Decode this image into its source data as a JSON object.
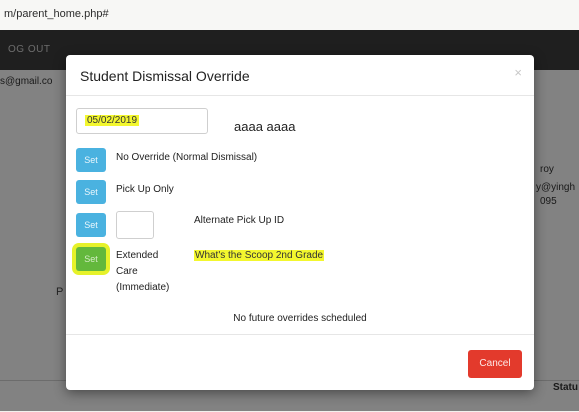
{
  "browser": {
    "url": "m/parent_home.php#"
  },
  "background": {
    "logout_label": "OG OUT",
    "email_fragment": "s@gmail.co",
    "right_fragment_1": "roy",
    "right_fragment_2": "y@yingh",
    "right_fragment_3": "095",
    "p_fragment": "P",
    "status_header": "Statu"
  },
  "modal": {
    "title": "Student Dismissal Override",
    "close_glyph": "×",
    "date_value": "05/02/2019",
    "student_name": "aaaa aaaa",
    "options": [
      {
        "button_label": "Set",
        "label": "No Override (Normal Dismissal)"
      },
      {
        "button_label": "Set",
        "label": "Pick Up Only"
      },
      {
        "button_label": "Set",
        "label": "Alternate Pick Up ID"
      },
      {
        "button_label": "Set",
        "label_line1": "Extended",
        "label_line2": "Care",
        "label_line3": "(Immediate)"
      }
    ],
    "activity": "What's the Scoop 2nd Grade",
    "no_future_text": "No future overrides scheduled",
    "cancel_label": "Cancel"
  },
  "colors": {
    "set_button": "#4ab2e0",
    "set_button_selected": "#63b83c",
    "highlight": "#f3f72e",
    "cancel_button": "#e33a2c"
  }
}
